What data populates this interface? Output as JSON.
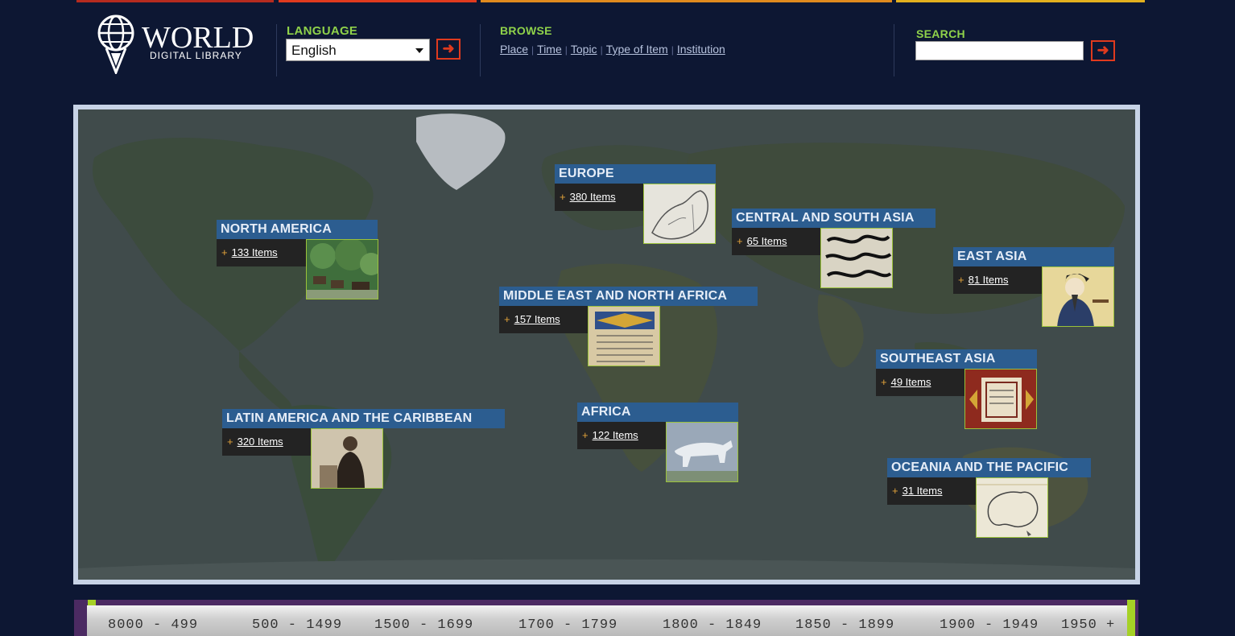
{
  "colors": {
    "background": "#0d1733",
    "accent_green": "#8fd24a",
    "accent_red": "#e03a1e",
    "region_title_bg": "#2c5d90",
    "timeline_bg": "#4b2a62",
    "timeline_handle": "#a6d126"
  },
  "logo": {
    "word": "WORLD",
    "subtitle": "DIGITAL LIBRARY",
    "icon": "globe-logo-icon"
  },
  "language": {
    "label": "LANGUAGE",
    "selected": "English",
    "go_icon": "arrow-right-icon"
  },
  "browse": {
    "label": "BROWSE",
    "links": [
      "Place",
      "Time",
      "Topic",
      "Type of Item",
      "Institution"
    ]
  },
  "search": {
    "label": "SEARCH",
    "value": "",
    "go_icon": "arrow-right-icon"
  },
  "regions": [
    {
      "name": "NORTH AMERICA",
      "items": "133 Items",
      "thumb": "forest-village-thumbnail"
    },
    {
      "name": "EUROPE",
      "items": "380 Items",
      "thumb": "europe-map-thumbnail"
    },
    {
      "name": "CENTRAL AND SOUTH ASIA",
      "items": "65 Items",
      "thumb": "calligraphy-thumbnail"
    },
    {
      "name": "EAST ASIA",
      "items": "81 Items",
      "thumb": "portrait-painting-thumbnail"
    },
    {
      "name": "MIDDLE EAST AND NORTH AFRICA",
      "items": "157 Items",
      "thumb": "manuscript-thumbnail"
    },
    {
      "name": "SOUTHEAST ASIA",
      "items": "49 Items",
      "thumb": "ornament-manuscript-thumbnail"
    },
    {
      "name": "LATIN AMERICA AND THE CARIBBEAN",
      "items": "320 Items",
      "thumb": "woman-photo-thumbnail"
    },
    {
      "name": "AFRICA",
      "items": "122 Items",
      "thumb": "rock-art-thumbnail"
    },
    {
      "name": "OCEANIA AND THE PACIFIC",
      "items": "31 Items",
      "thumb": "australia-map-thumbnail"
    }
  ],
  "timeline": {
    "periods": [
      "8000 - 499",
      "500 - 1499",
      "1500 - 1699",
      "1700 - 1799",
      "1800 - 1849",
      "1850 - 1899",
      "1900 - 1949",
      "1950 +"
    ]
  }
}
